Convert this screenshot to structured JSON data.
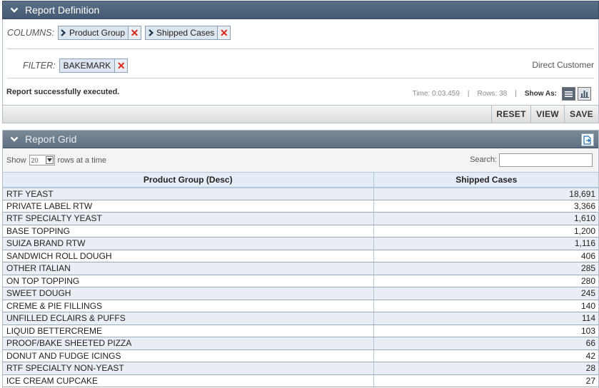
{
  "definition": {
    "title": "Report Definition",
    "columns_label": "COLUMNS:",
    "columns": [
      {
        "label": "Product Group"
      },
      {
        "label": "Shipped Cases"
      }
    ],
    "filter_label": "FILTER:",
    "filters": [
      {
        "label": "BAKEMARK"
      }
    ],
    "filter_hint": "Direct Customer",
    "status_message": "Report successfully executed.",
    "time": "Time: 0:03.459",
    "rows": "Rows: 38",
    "show_as": "Show As:",
    "actions": [
      "RESET",
      "VIEW",
      "SAVE"
    ]
  },
  "grid": {
    "title": "Report Grid",
    "show_label": "Show",
    "page_size": "20",
    "rows_label": "rows at a time",
    "search_label": "Search:",
    "search_value": "",
    "headers": [
      "Product Group (Desc)",
      "Shipped Cases"
    ],
    "rows": [
      [
        "RTF YEAST",
        "18,691"
      ],
      [
        "PRIVATE LABEL RTW",
        "3,366"
      ],
      [
        "RTF SPECIALTY YEAST",
        "1,610"
      ],
      [
        "BASE TOPPING",
        "1,200"
      ],
      [
        "SUIZA BRAND RTW",
        "1,116"
      ],
      [
        "SANDWICH ROLL DOUGH",
        "406"
      ],
      [
        "OTHER ITALIAN",
        "285"
      ],
      [
        "ON TOP TOPPING",
        "280"
      ],
      [
        "SWEET DOUGH",
        "245"
      ],
      [
        "CREME & PIE FILLINGS",
        "140"
      ],
      [
        "UNFILLED ECLAIRS & PUFFS",
        "114"
      ],
      [
        "LIQUID BETTERCREME",
        "103"
      ],
      [
        "PROOF/BAKE SHEETED PIZZA",
        "66"
      ],
      [
        "DONUT AND FUDGE ICINGS",
        "42"
      ],
      [
        "RTF SPECIALTY NON-YEAST",
        "28"
      ],
      [
        "ICE CREAM CUPCAKE",
        "27"
      ]
    ]
  },
  "colors": {
    "header_bar": "#4f647b",
    "remove_x": "#d9261c",
    "chip_bg": "#dde6ef",
    "row_alt": "#e9eef5"
  }
}
